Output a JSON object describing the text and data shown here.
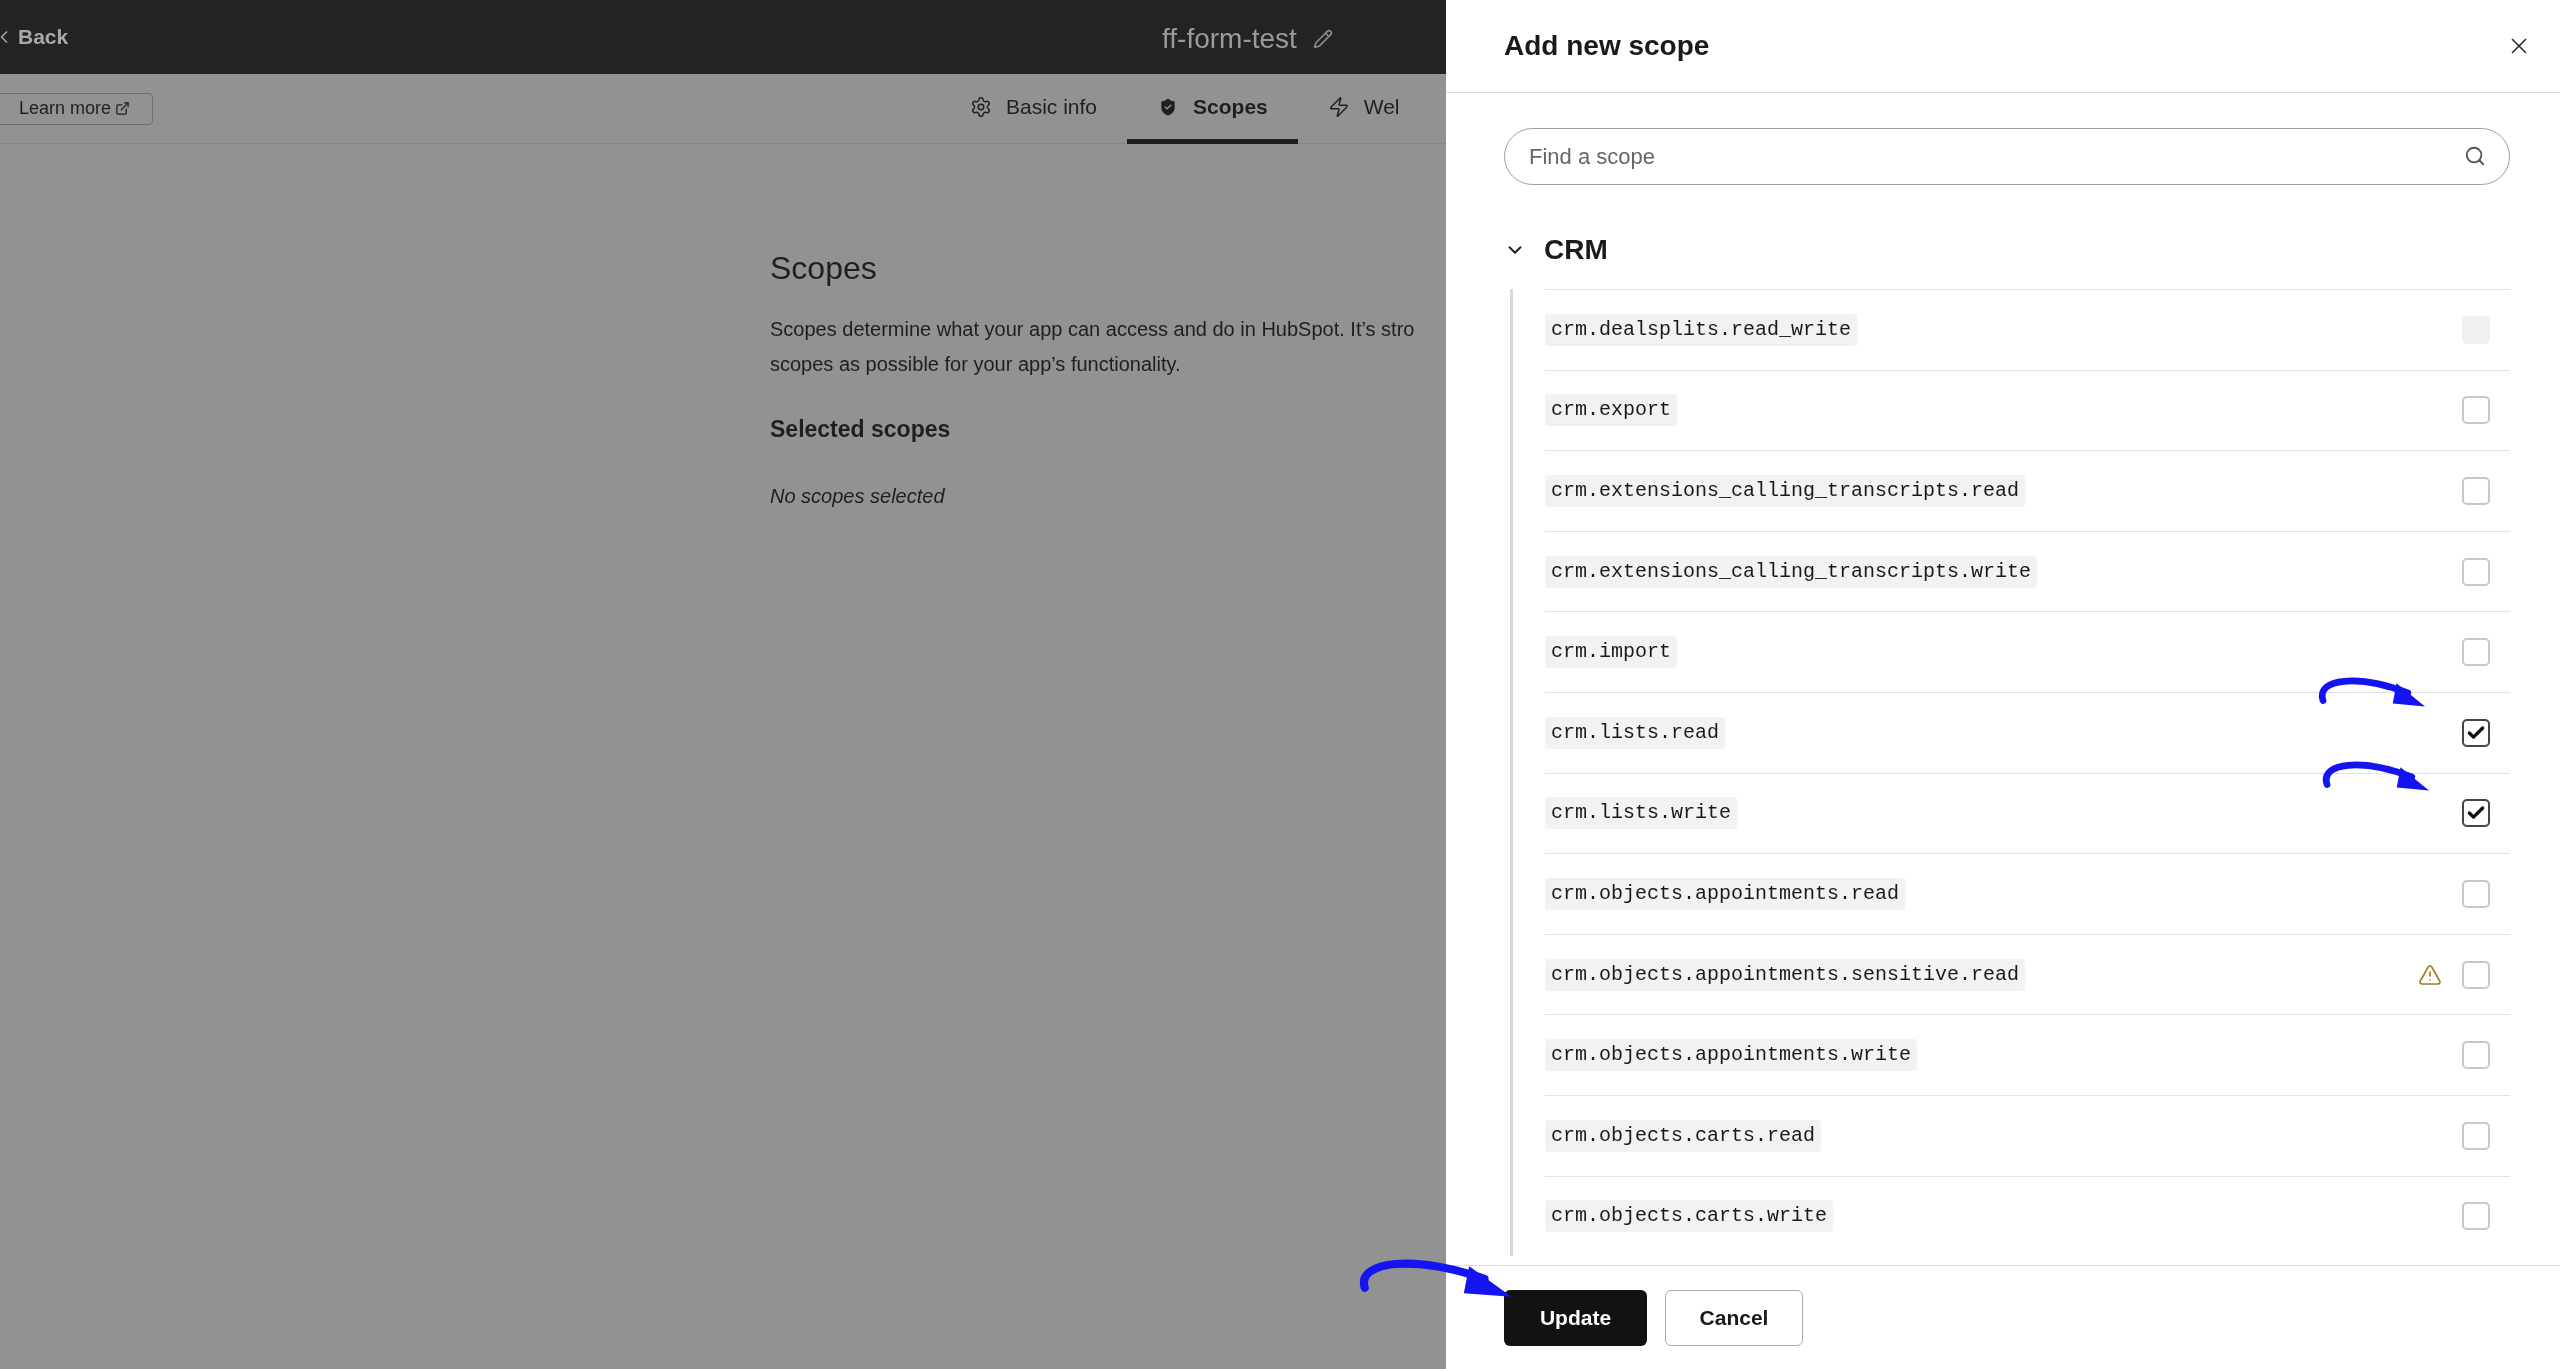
{
  "topbar": {
    "back": "Back",
    "app_name": "ff-form-test"
  },
  "learn_more": "Learn more",
  "tabs": [
    {
      "label": "Basic info",
      "kind": "gear",
      "selected": false
    },
    {
      "label": "Scopes",
      "kind": "shield",
      "selected": true
    },
    {
      "label": "Wel",
      "kind": "bolt",
      "selected": false
    }
  ],
  "content": {
    "title": "Scopes",
    "description": "Scopes determine what your app can access and do in HubSpot. It’s stro\nscopes as possible for your app’s functionality.",
    "selected_heading": "Selected scopes",
    "empty_text": "No scopes selected"
  },
  "panel": {
    "title": "Add new scope",
    "search": {
      "placeholder": "Find a scope"
    },
    "group": {
      "name": "CRM",
      "expanded": true,
      "scopes": [
        {
          "name": "crm.dealsplits.read_write",
          "checked": false,
          "disabled": true,
          "warning": false
        },
        {
          "name": "crm.export",
          "checked": false,
          "disabled": false,
          "warning": false
        },
        {
          "name": "crm.extensions_calling_transcripts.read",
          "checked": false,
          "disabled": false,
          "warning": false
        },
        {
          "name": "crm.extensions_calling_transcripts.write",
          "checked": false,
          "disabled": false,
          "warning": false
        },
        {
          "name": "crm.import",
          "checked": false,
          "disabled": false,
          "warning": false
        },
        {
          "name": "crm.lists.read",
          "checked": true,
          "disabled": false,
          "warning": false
        },
        {
          "name": "crm.lists.write",
          "checked": true,
          "disabled": false,
          "warning": false
        },
        {
          "name": "crm.objects.appointments.read",
          "checked": false,
          "disabled": false,
          "warning": false
        },
        {
          "name": "crm.objects.appointments.sensitive.read",
          "checked": false,
          "disabled": false,
          "warning": true
        },
        {
          "name": "crm.objects.appointments.write",
          "checked": false,
          "disabled": false,
          "warning": false
        },
        {
          "name": "crm.objects.carts.read",
          "checked": false,
          "disabled": false,
          "warning": false
        },
        {
          "name": "crm.objects.carts.write",
          "checked": false,
          "disabled": false,
          "warning": false
        }
      ]
    }
  },
  "buttons": [
    {
      "label": "Update",
      "kind": "primary"
    },
    {
      "label": "Cancel",
      "kind": "secondary"
    }
  ]
}
